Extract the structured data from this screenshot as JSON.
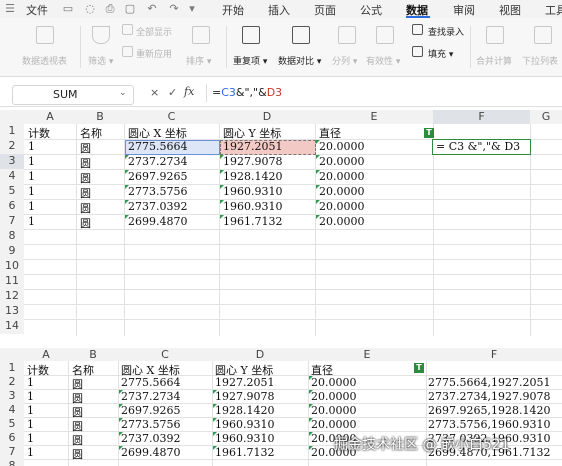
{
  "menu": {
    "file": "文件",
    "tabs": [
      "开始",
      "插入",
      "页面",
      "公式",
      "数据",
      "审阅",
      "视图",
      "工具"
    ],
    "active_tab": "数据"
  },
  "ribbon": {
    "groups": [
      {
        "label": "数据透视表",
        "active": false
      },
      {
        "label": "筛选 ▾",
        "active": false
      },
      {
        "label": "全部显示",
        "active": false
      },
      {
        "label": "重新应用",
        "active": false
      },
      {
        "label": "排序 ▾",
        "active": false
      },
      {
        "label": "重复项 ▾",
        "active": true
      },
      {
        "label": "数据对比 ▾",
        "active": true
      },
      {
        "label": "分列 ▾",
        "active": false
      },
      {
        "label": "有效性 ▾",
        "active": false
      },
      {
        "label": "查找录入",
        "active": true
      },
      {
        "label": "填充 ▾",
        "active": true
      },
      {
        "label": "合并计算",
        "active": false
      },
      {
        "label": "下拉列表",
        "active": false
      }
    ]
  },
  "formula_bar": {
    "name_box": "SUM",
    "cancel": "×",
    "confirm": "✓",
    "fx": "fx",
    "formula_prefix": "=",
    "formula_ref1": "C3",
    "formula_mid": "&\",\"&",
    "formula_ref2": "D3"
  },
  "top_sheet": {
    "columns": [
      "A",
      "B",
      "C",
      "D",
      "E",
      "F",
      "G"
    ],
    "rows": [
      "1",
      "2",
      "3",
      "4",
      "5",
      "6",
      "7",
      "8",
      "9",
      "10",
      "11",
      "12",
      "13",
      "14"
    ],
    "header": [
      "计数",
      "名称",
      "圆心 X 坐标",
      "圆心 Y 坐标",
      "直径"
    ],
    "data": [
      [
        "1",
        "圆",
        "2775.5664",
        "1927.2051",
        "20.0000"
      ],
      [
        "1",
        "圆",
        "2737.2734",
        "1927.9078",
        "20.0000"
      ],
      [
        "1",
        "圆",
        "2697.9265",
        "1928.1420",
        "20.0000"
      ],
      [
        "1",
        "圆",
        "2773.5756",
        "1960.9310",
        "20.0000"
      ],
      [
        "1",
        "圆",
        "2737.0392",
        "1960.9310",
        "20.0000"
      ],
      [
        "1",
        "圆",
        "2699.4870",
        "1961.7132",
        "20.0000"
      ]
    ],
    "editing_cell_text": "= C3 &\",\"& D3",
    "badge": "T"
  },
  "bottom_sheet": {
    "columns": [
      "A",
      "B",
      "C",
      "D",
      "E",
      "F"
    ],
    "rows": [
      "1",
      "2",
      "3",
      "4",
      "5",
      "6",
      "7",
      "8"
    ],
    "header": [
      "计数",
      "名称",
      "圆心 X 坐标",
      "圆心 Y 坐标",
      "直径"
    ],
    "data": [
      [
        "1",
        "圆",
        "2775.5664",
        "1927.2051",
        "20.0000",
        "2775.5664,1927.2051"
      ],
      [
        "1",
        "圆",
        "2737.2734",
        "1927.9078",
        "20.0000",
        "2737.2734,1927.9078"
      ],
      [
        "1",
        "圆",
        "2697.9265",
        "1928.1420",
        "20.0000",
        "2697.9265,1928.1420"
      ],
      [
        "1",
        "圆",
        "2773.5756",
        "1960.9310",
        "20.0000",
        "2773.5756,1960.9310"
      ],
      [
        "1",
        "圆",
        "2737.0392",
        "1960.9310",
        "20.0000",
        "2737.0392,1960.9310"
      ],
      [
        "1",
        "圆",
        "2699.4870",
        "1961.7132",
        "20.0000",
        "2699.4870,1961.7132"
      ]
    ],
    "badge": "T"
  },
  "watermark": "掘金技术社区 @ 嵌小白521",
  "colors": {
    "accent": "#2b6bde",
    "selected_c3": "#dce6f7",
    "selected_d3": "#f2c9c4",
    "green": "#2e8b3e"
  }
}
